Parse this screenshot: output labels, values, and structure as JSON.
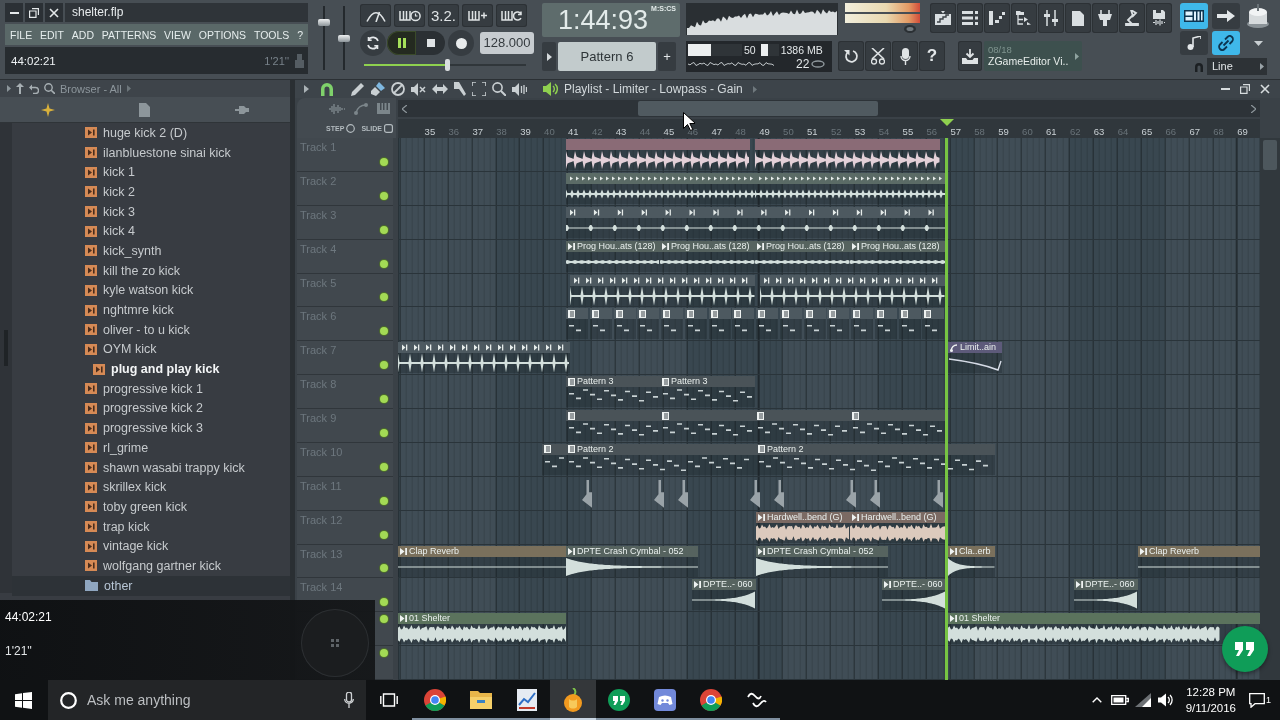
{
  "window": {
    "title": "shelter.flp"
  },
  "menu": [
    "FILE",
    "EDIT",
    "ADD",
    "PATTERNS",
    "VIEW",
    "OPTIONS",
    "TOOLS",
    "?"
  ],
  "hint_bar": {
    "text": "44:02:21",
    "value": "1'21''"
  },
  "master_volume": {
    "level": 0.78
  },
  "master_pitch": {
    "level": 0.5
  },
  "transport": {
    "countdown": "3.2.",
    "playing": true,
    "recording": false,
    "tempo": "128.000",
    "song_position": {
      "level": 0.53
    },
    "time": "1:44:93",
    "time_format": "M:S:CS",
    "pattern": "Pattern 6",
    "add_pattern": "+"
  },
  "monitor": {
    "cpu": {
      "value": "50",
      "level": 0.42
    },
    "memory": {
      "value": "1386 MB",
      "level": 0.4
    },
    "polyphony": "22"
  },
  "help": "?",
  "news": {
    "count": "08/18",
    "title": "ZGameEditor Vi.."
  },
  "toggles": [
    {
      "kind": "keyboard",
      "on": true
    },
    {
      "kind": "arrow",
      "on": false
    },
    {
      "kind": "step",
      "on": false
    },
    {
      "kind": "link",
      "on": true
    }
  ],
  "snap": {
    "value": "Line"
  },
  "browser": {
    "title": "Browser - All",
    "items": [
      {
        "kind": "file",
        "label": "huge kick 2 (D)",
        "selected": false
      },
      {
        "kind": "file",
        "label": "ilanbluestone sinai kick",
        "selected": false
      },
      {
        "kind": "file",
        "label": "kick 1",
        "selected": false
      },
      {
        "kind": "file",
        "label": "kick 2",
        "selected": false
      },
      {
        "kind": "file",
        "label": "kick 3",
        "selected": false
      },
      {
        "kind": "file",
        "label": "kick 4",
        "selected": false
      },
      {
        "kind": "file",
        "label": "kick_synth",
        "selected": false
      },
      {
        "kind": "file",
        "label": "kill the zo kick",
        "selected": false
      },
      {
        "kind": "file",
        "label": "kyle watson kick",
        "selected": false
      },
      {
        "kind": "file",
        "label": "nghtmre kick",
        "selected": false
      },
      {
        "kind": "file",
        "label": "oliver - to u kick",
        "selected": false
      },
      {
        "kind": "file",
        "label": "OYM kick",
        "selected": false
      },
      {
        "kind": "file",
        "label": "plug and play kick",
        "selected": true
      },
      {
        "kind": "file",
        "label": "progressive kick 1",
        "selected": false
      },
      {
        "kind": "file",
        "label": "progressive kick 2",
        "selected": false
      },
      {
        "kind": "file",
        "label": "progressive kick 3",
        "selected": false
      },
      {
        "kind": "file",
        "label": "rl_grime",
        "selected": false
      },
      {
        "kind": "file",
        "label": "shawn wasabi trappy kick",
        "selected": false
      },
      {
        "kind": "file",
        "label": "skrillex kick",
        "selected": false
      },
      {
        "kind": "file",
        "label": "toby green kick",
        "selected": false
      },
      {
        "kind": "file",
        "label": "trap kick",
        "selected": false
      },
      {
        "kind": "file",
        "label": "vintage kick",
        "selected": false
      },
      {
        "kind": "file",
        "label": "wolfgang gartner kick",
        "selected": false
      },
      {
        "kind": "folder",
        "label": "other",
        "selected": false
      }
    ]
  },
  "playlist": {
    "title": "Playlist - Limiter - Lowpass - Gain",
    "step": "STEP",
    "slide": "SLIDE",
    "ruler": [
      {
        "label": "35",
        "major": true
      },
      {
        "label": "36",
        "major": false
      },
      {
        "label": "37",
        "major": true
      },
      {
        "label": "38",
        "major": false
      },
      {
        "label": "39",
        "major": true
      },
      {
        "label": "40",
        "major": false
      },
      {
        "label": "41",
        "major": true
      },
      {
        "label": "42",
        "major": false
      },
      {
        "label": "43",
        "major": true
      },
      {
        "label": "44",
        "major": false
      },
      {
        "label": "45",
        "major": true
      },
      {
        "label": "46",
        "major": false
      },
      {
        "label": "47",
        "major": true
      },
      {
        "label": "48",
        "major": false
      },
      {
        "label": "49",
        "major": true
      },
      {
        "label": "50",
        "major": false
      },
      {
        "label": "51",
        "major": true
      },
      {
        "label": "52",
        "major": false
      },
      {
        "label": "53",
        "major": true
      },
      {
        "label": "54",
        "major": false
      },
      {
        "label": "55",
        "major": true
      },
      {
        "label": "56",
        "major": false
      },
      {
        "label": "57",
        "major": true
      },
      {
        "label": "58",
        "major": false
      },
      {
        "label": "59",
        "major": true
      },
      {
        "label": "60",
        "major": false
      },
      {
        "label": "61",
        "major": true
      },
      {
        "label": "62",
        "major": false
      },
      {
        "label": "63",
        "major": true
      },
      {
        "label": "64",
        "major": false
      },
      {
        "label": "65",
        "major": true
      },
      {
        "label": "66",
        "major": false
      },
      {
        "label": "67",
        "major": true
      },
      {
        "label": "68",
        "major": false
      },
      {
        "label": "69",
        "major": true
      }
    ],
    "tracks": [
      {
        "name": "Track 1",
        "enabled": true,
        "clips": [
          {
            "kind": "audio",
            "color": "#8a6b76"
          },
          {
            "kind": "audio",
            "color": "#8a6b76"
          }
        ]
      },
      {
        "name": "Track 2",
        "enabled": true,
        "clips": [
          {
            "kind": "audio",
            "color": "#5b6b66"
          },
          {
            "kind": "audio",
            "color": "#5b6b66"
          }
        ]
      },
      {
        "name": "Track 3",
        "enabled": true,
        "clips": [
          {
            "kind": "audio",
            "color": "#4d5960"
          }
        ]
      },
      {
        "name": "Track 4",
        "enabled": true,
        "clips": [
          {
            "kind": "audio",
            "label": "Prog Hou..ats (128)",
            "color": "#56635f"
          },
          {
            "kind": "audio",
            "label": "Prog Hou..ats (128)",
            "color": "#56635f"
          },
          {
            "kind": "audio",
            "label": "Prog Hou..ats (128)",
            "color": "#56635f"
          },
          {
            "kind": "audio",
            "label": "Prog Hou..ats (128)",
            "color": "#56635f"
          }
        ]
      },
      {
        "name": "Track 5",
        "enabled": true,
        "clips": [
          {
            "kind": "audio",
            "color": "#4d5960"
          },
          {
            "kind": "audio",
            "color": "#4d5960"
          }
        ]
      },
      {
        "name": "Track 6",
        "enabled": true,
        "clips": [
          {
            "kind": "pattern",
            "color": "#4d5960"
          },
          {
            "kind": "pattern",
            "color": "#4d5960"
          },
          {
            "kind": "pattern",
            "color": "#4d5960"
          },
          {
            "kind": "pattern",
            "color": "#4d5960"
          },
          {
            "kind": "pattern",
            "color": "#4d5960"
          },
          {
            "kind": "pattern",
            "color": "#4d5960"
          },
          {
            "kind": "pattern",
            "color": "#4d5960"
          },
          {
            "kind": "pattern",
            "color": "#4d5960"
          },
          {
            "kind": "pattern",
            "color": "#4d5960"
          },
          {
            "kind": "pattern",
            "color": "#4d5960"
          },
          {
            "kind": "pattern",
            "color": "#4d5960"
          },
          {
            "kind": "pattern",
            "color": "#4d5960"
          },
          {
            "kind": "pattern",
            "color": "#4d5960"
          },
          {
            "kind": "pattern",
            "color": "#4d5960"
          },
          {
            "kind": "pattern",
            "color": "#4d5960"
          },
          {
            "kind": "pattern",
            "color": "#4d5960"
          }
        ]
      },
      {
        "name": "Track 7",
        "enabled": true,
        "clips": [
          {
            "kind": "audio",
            "color": "#4d5960"
          },
          {
            "kind": "automation",
            "label": "Limit..ain",
            "color": "#5d5a7a"
          }
        ]
      },
      {
        "name": "Track 8",
        "enabled": true,
        "clips": [
          {
            "kind": "pattern",
            "label": "Pattern 3",
            "color": "#4a5358"
          },
          {
            "kind": "pattern",
            "label": "Pattern 3",
            "color": "#4a5358"
          }
        ]
      },
      {
        "name": "Track 9",
        "enabled": true,
        "clips": [
          {
            "kind": "pattern",
            "color": "#4a5358"
          },
          {
            "kind": "pattern",
            "color": "#4a5358"
          },
          {
            "kind": "pattern",
            "color": "#4a5358"
          },
          {
            "kind": "pattern",
            "color": "#4a5358"
          }
        ]
      },
      {
        "name": "Track 10",
        "enabled": true,
        "clips": [
          {
            "kind": "pattern",
            "color": "#4a5358"
          },
          {
            "kind": "pattern",
            "label": "Pattern 2",
            "color": "#4a5358"
          },
          {
            "kind": "pattern",
            "label": "Pattern 2",
            "color": "#4a5358"
          }
        ]
      },
      {
        "name": "Track 11",
        "enabled": true,
        "clips": [
          {
            "kind": "marker",
            "color": "#9aa3a8"
          },
          {
            "kind": "marker",
            "color": "#9aa3a8"
          },
          {
            "kind": "marker",
            "color": "#9aa3a8"
          },
          {
            "kind": "marker",
            "color": "#9aa3a8"
          },
          {
            "kind": "marker",
            "color": "#9aa3a8"
          },
          {
            "kind": "marker",
            "color": "#9aa3a8"
          },
          {
            "kind": "marker",
            "color": "#9aa3a8"
          },
          {
            "kind": "marker",
            "color": "#9aa3a8"
          }
        ]
      },
      {
        "name": "Track 12",
        "enabled": true,
        "clips": [
          {
            "kind": "audio",
            "label": "Hardwell..bend (G)",
            "color": "#7b6a63"
          },
          {
            "kind": "audio",
            "label": "Hardwell..bend (G)",
            "color": "#7b6a63"
          }
        ]
      },
      {
        "name": "Track 13",
        "enabled": true,
        "clips": [
          {
            "kind": "audio",
            "label": "Clap Reverb",
            "color": "#7a705c"
          },
          {
            "kind": "audio",
            "label": "DPTE Crash Cymbal - 052",
            "color": "#56635f"
          },
          {
            "kind": "audio",
            "label": "DPTE Crash Cymbal - 052",
            "color": "#56635f"
          },
          {
            "kind": "audio",
            "label": "Cla..erb",
            "color": "#7a705c"
          },
          {
            "kind": "audio",
            "label": "Clap Reverb",
            "color": "#7a705c"
          }
        ]
      },
      {
        "name": "Track 14",
        "enabled": true,
        "clips": [
          {
            "kind": "audio",
            "label": "DPTE..- 060",
            "color": "#56635f"
          },
          {
            "kind": "audio",
            "label": "DPTE..- 060",
            "color": "#56635f"
          },
          {
            "kind": "audio",
            "label": "DPTE..- 060",
            "color": "#56635f"
          }
        ]
      },
      {
        "enabled": true,
        "clips": [
          {
            "kind": "audio",
            "label": "01 Shelter",
            "color": "#5b735d"
          },
          {
            "kind": "audio",
            "label": "01 Shelter",
            "color": "#5b735d"
          }
        ]
      },
      {
        "enabled": true
      }
    ]
  },
  "recorder_overlay": {
    "time": "44:02:21",
    "duration": "1'21''"
  },
  "taskbar": {
    "search": {
      "placeholder": "Ask me anything"
    },
    "apps": [
      {
        "kind": "browser",
        "selected": false
      },
      {
        "kind": "folder",
        "selected": false
      },
      {
        "kind": "document",
        "selected": false
      },
      {
        "kind": "fruit",
        "selected": true
      },
      {
        "kind": "chat",
        "selected": false
      },
      {
        "kind": "gamepad",
        "selected": false
      },
      {
        "kind": "browser",
        "selected": false
      },
      {
        "kind": "squiggle",
        "selected": false
      }
    ],
    "time": "12:28 PM",
    "date": "9/11/2016",
    "notifications": "1"
  }
}
